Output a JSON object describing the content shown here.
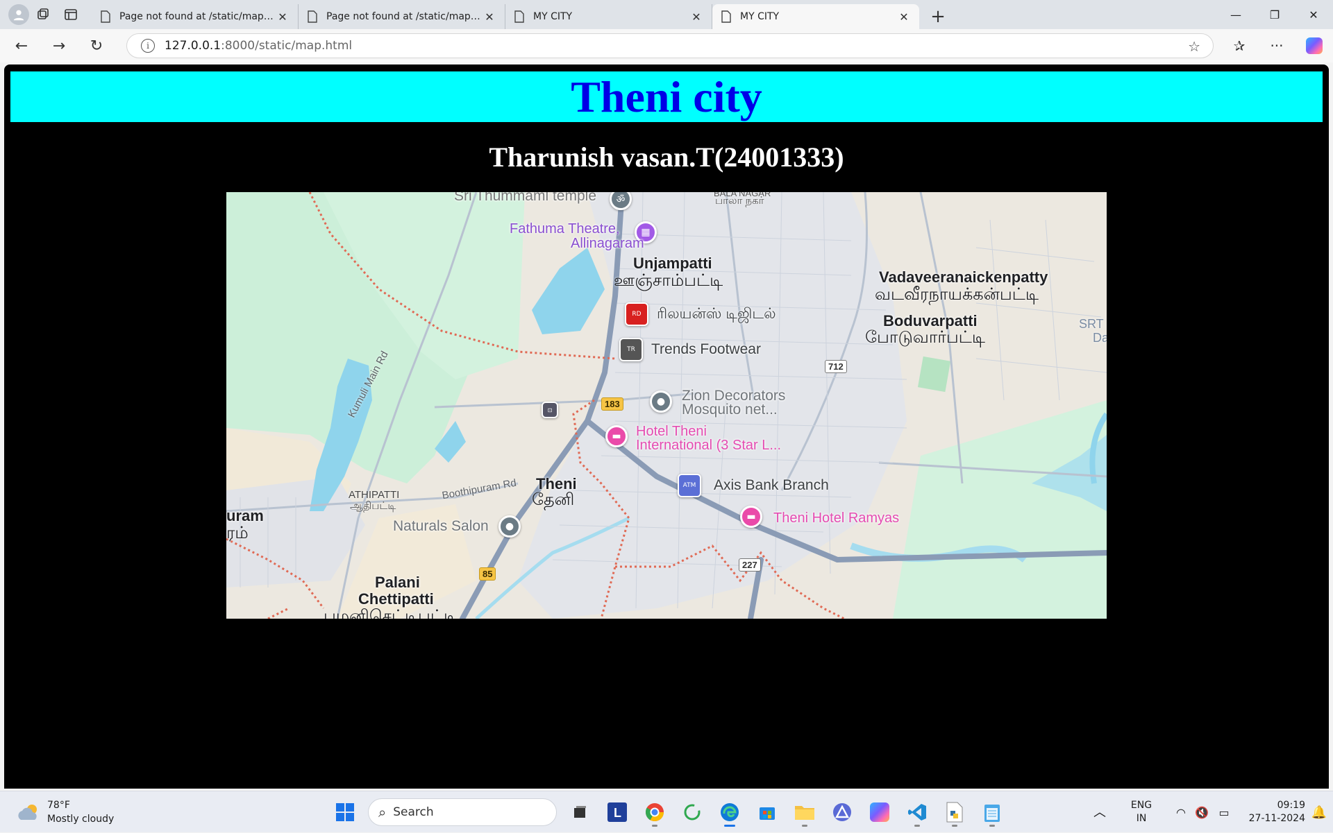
{
  "browser": {
    "tabs": [
      {
        "title": "Page not found at /static/map.html",
        "active": false
      },
      {
        "title": "Page not found at /static/map.html",
        "active": false
      },
      {
        "title": "MY CITY",
        "active": false
      },
      {
        "title": "MY CITY",
        "active": true
      }
    ],
    "url_host": "127.0.0.1",
    "url_rest": ":8000/static/map.html",
    "window_controls": [
      "minimize",
      "restore",
      "close"
    ]
  },
  "page": {
    "heading": "Theni city",
    "subheading": "Tharunish vasan.T(24001333)",
    "header_bg": "#00ffff",
    "heading_color": "#0000e6",
    "background": "#000000"
  },
  "map": {
    "labels": {
      "sri_thummami": "Sri Thummaml temple",
      "bala_nagar": "BALA NAGAR",
      "bala_nagar_ta": "பாலா நகர்",
      "fathuma": "Fathuma Theatre,",
      "allinagaram": "Allinagaram",
      "unjampatti": "Unjampatti",
      "unjampatti_ta": "ஊஞ்சாம்பட்டி",
      "vadaveeranaickenpatty": "Vadaveeranaickenpatty",
      "vadaveeranaickenpatty_ta": "வடவீரநாயக்கன்பட்டி",
      "boduvarpatti": "Boduvarpatti",
      "boduvarpatti_ta": "போடுவார்பட்டி",
      "reliance": "ரிலயன்ஸ் டிஜிடல்",
      "trends": "Trends Footwear",
      "zion1": "Zion Decorators",
      "zion2": "Mosquito net...",
      "hotel_theni1": "Hotel Theni",
      "hotel_theni2": "International (3 Star L...",
      "axis": "Axis Bank Branch",
      "ramyas": "Theni Hotel Ramyas",
      "theni": "Theni",
      "theni_ta": "தேனி",
      "athipatti": "ATHIPATTI",
      "athipatti_ta": "ஆதிபட்டி",
      "boothipuram": "Boothipuram Rd",
      "kumuli": "Kumuli Main Rd",
      "naturals": "Naturals Salon",
      "palani1": "Palani",
      "palani2": "Chettipatti",
      "palani_ta": "பழனிசெட்டிபட்டி",
      "uram": "uram",
      "uram_ta": "ரம்",
      "srt": "SRT",
      "da": "Da"
    },
    "shields": {
      "r183": "183",
      "r712": "712",
      "r85": "85",
      "r227": "227"
    }
  },
  "taskbar": {
    "temperature": "78°F",
    "condition": "Mostly cloudy",
    "search_placeholder": "Search",
    "lang1": "ENG",
    "lang2": "IN",
    "time": "09:19",
    "date": "27-11-2024"
  }
}
